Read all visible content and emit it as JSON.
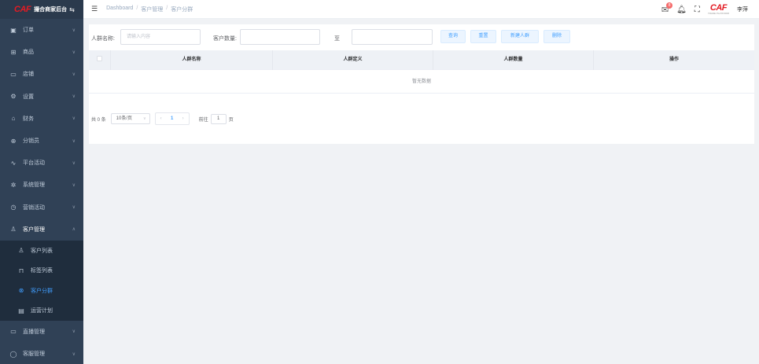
{
  "brand": {
    "logo_text": "CAF",
    "title": "撮合商家后台",
    "switch_icon": "switch-arrows-icon"
  },
  "menu": [
    {
      "label": "订单",
      "icon": "order-icon",
      "glyph": "▣"
    },
    {
      "label": "商品",
      "icon": "goods-icon",
      "glyph": "⊞"
    },
    {
      "label": "店铺",
      "icon": "shop-icon",
      "glyph": "▭"
    },
    {
      "label": "设置",
      "icon": "settings-icon",
      "glyph": "⚙"
    },
    {
      "label": "财务",
      "icon": "finance-icon",
      "glyph": "⌂"
    },
    {
      "label": "分销员",
      "icon": "distributor-icon",
      "glyph": "⊕"
    },
    {
      "label": "平台活动",
      "icon": "activity-icon",
      "glyph": "∿"
    },
    {
      "label": "系统管理",
      "icon": "system-icon",
      "glyph": "✲"
    },
    {
      "label": "营销活动",
      "icon": "marketing-icon",
      "glyph": "◷"
    },
    {
      "label": "客户管理",
      "icon": "customer-icon",
      "glyph": "♙"
    }
  ],
  "submenu": [
    {
      "label": "客户列表",
      "icon": "user-icon",
      "glyph": "♙"
    },
    {
      "label": "标签列表",
      "icon": "bookmark-icon",
      "glyph": "⊓"
    },
    {
      "label": "客户分群",
      "icon": "group-icon",
      "glyph": "⊗"
    },
    {
      "label": "运营计划",
      "icon": "plan-icon",
      "glyph": "▤"
    }
  ],
  "menu_bottom": [
    {
      "label": "直播管理",
      "icon": "live-icon",
      "glyph": "▭"
    },
    {
      "label": "客服管理",
      "icon": "service-icon",
      "glyph": "◯"
    }
  ],
  "header": {
    "breadcrumb": [
      "Dashboard",
      "客户管理",
      "客户分群"
    ],
    "mail_badge": "8",
    "avatar_logo": "CAF",
    "avatar_sub": "TRADE PLATFORM",
    "username": "李萍"
  },
  "search": {
    "name_label": "人群名称:",
    "name_placeholder": "请输入内容",
    "count_label": "客户数量:",
    "to_label": "至",
    "buttons": {
      "query": "查询",
      "reset": "重置",
      "create": "新建人群",
      "delete": "删除"
    }
  },
  "table": {
    "columns": [
      "人群名称",
      "人群定义",
      "人群数量",
      "操作"
    ],
    "empty_text": "暂无数据"
  },
  "pagination": {
    "total": "共 0 条",
    "page_size": "10条/页",
    "current_page": "1",
    "goto_prefix": "前往",
    "goto_value": "1",
    "goto_suffix": "页"
  }
}
